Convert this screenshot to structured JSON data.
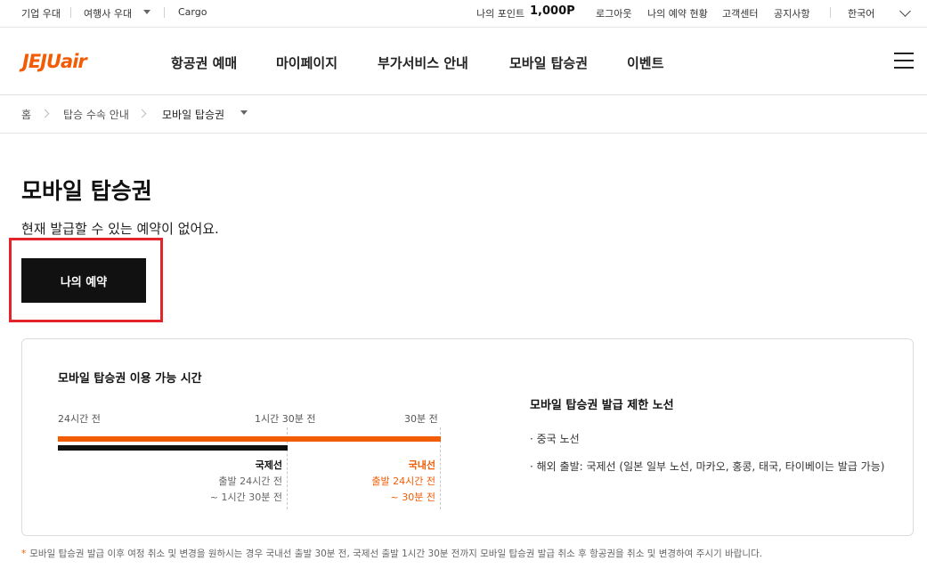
{
  "util": {
    "corp": "기업 우대",
    "agency": "여행사 우대",
    "cargo": "Cargo",
    "points_label": "나의 포인트",
    "points_value": "1,000P",
    "logout": "로그아웃",
    "my_reservation_status": "나의 예약 현황",
    "customer_center": "고객센터",
    "notice": "공지사항",
    "language": "한국어"
  },
  "header": {
    "logo": "JEJUair",
    "nav": [
      "항공권 예매",
      "마이페이지",
      "부가서비스 안내",
      "모바일 탑승권",
      "이벤트"
    ]
  },
  "breadcrumb": [
    "홈",
    "탑승 수속 안내",
    "모바일 탑승권"
  ],
  "main": {
    "title": "모바일 탑승권",
    "description": "현재 발급할 수 있는 예약이 없어요.",
    "my_reservation_button": "나의 예약"
  },
  "info": {
    "time_title": "모바일 탑승권 이용 가능 시간",
    "time_labels": [
      "24시간 전",
      "1시간 30분 전",
      "30분 전"
    ],
    "international": {
      "label": "국제선",
      "line1": "출발 24시간 전",
      "line2": "~ 1시간 30분 전"
    },
    "domestic": {
      "label": "국내선",
      "line1": "출발 24시간 전",
      "line2": "~ 30분 전"
    },
    "restrict_title": "모바일 탑승권 발급 제한 노선",
    "restrict_items": [
      "· 중국 노선",
      "· 해외 출발: 국제선 (일본 일부 노선, 마카오, 홍콩, 태국, 타이베이는 발급 가능)"
    ]
  },
  "footnote": {
    "star": "*",
    "text": "모바일 탑승권 발급 이후 여정 취소 및 변경을 원하시는 경우 국내선 출발 30분 전, 국제선 출발 1시간 30분 전까지 모바일 탑승권 발급 취소 후 항공권을 취소 및 변경하여 주시기 바랍니다."
  },
  "colors": {
    "brand": "#f25c05",
    "button": "#111111",
    "highlight": "#e3242b"
  }
}
